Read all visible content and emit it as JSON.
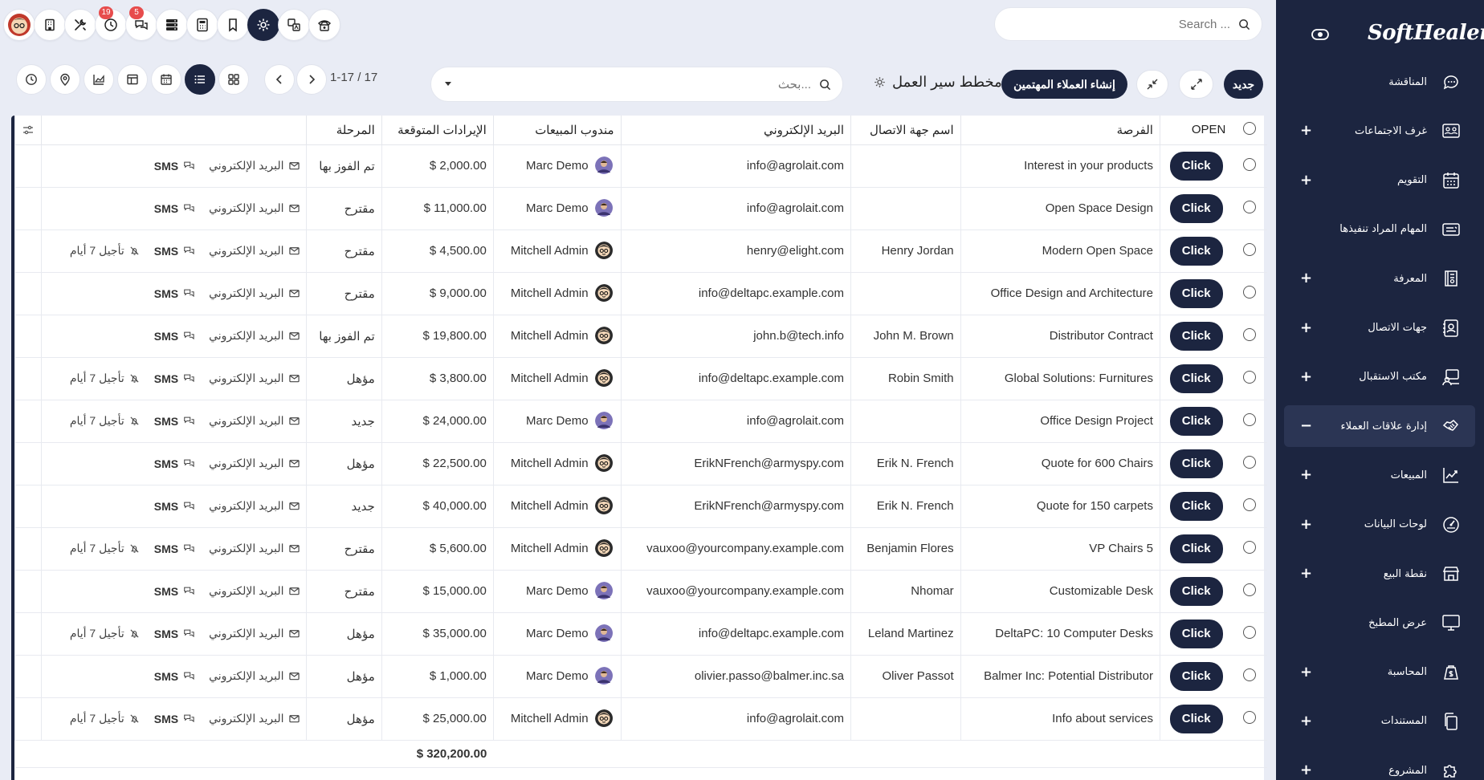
{
  "topbar": {
    "search_placeholder": "Search ...",
    "badges": {
      "activity": "19",
      "messages": "5"
    }
  },
  "control_panel": {
    "new_label": "جديد",
    "create_leads_label": "إنشاء العملاء المهتمين",
    "kanban_title": "مخطط سير العمل",
    "search_placeholder": "بحث...",
    "pager": "1-17 / 17",
    "views": [
      "kanban",
      "list",
      "calendar",
      "pivot",
      "graph",
      "map",
      "activity"
    ],
    "active_view": "list"
  },
  "table": {
    "columns": {
      "open": "OPEN",
      "opportunity": "الفرصة",
      "contact": "اسم جهة الاتصال",
      "email": "البريد الإلكتروني",
      "salesperson": "مندوب المبيعات",
      "revenue": "الإيرادات المتوقعة",
      "stage": "المرحلة"
    },
    "button_label": "Click",
    "email_action": "البريد الإلكتروني",
    "sms_action": "SMS",
    "snooze_action": "تأجيل 7 أيام",
    "rows": [
      {
        "opportunity": "Interest in your products",
        "contact": "",
        "email": "info@agrolait.com",
        "salesperson": "Marc Demo",
        "revenue": "$ 2,000.00",
        "stage": "تم الفوز بها",
        "snooze": false
      },
      {
        "opportunity": "Open Space Design",
        "contact": "",
        "email": "info@agrolait.com",
        "salesperson": "Marc Demo",
        "revenue": "$ 11,000.00",
        "stage": "مقترح",
        "snooze": false
      },
      {
        "opportunity": "Modern Open Space",
        "contact": "Henry Jordan",
        "email": "henry@elight.com",
        "salesperson": "Mitchell Admin",
        "revenue": "$ 4,500.00",
        "stage": "مقترح",
        "snooze": true
      },
      {
        "opportunity": "Office Design and Architecture",
        "contact": "",
        "email": "info@deltapc.example.com",
        "salesperson": "Mitchell Admin",
        "revenue": "$ 9,000.00",
        "stage": "مقترح",
        "snooze": false
      },
      {
        "opportunity": "Distributor Contract",
        "contact": "John M. Brown",
        "email": "john.b@tech.info",
        "salesperson": "Mitchell Admin",
        "revenue": "$ 19,800.00",
        "stage": "تم الفوز بها",
        "snooze": false
      },
      {
        "opportunity": "Global Solutions: Furnitures",
        "contact": "Robin Smith",
        "email": "info@deltapc.example.com",
        "salesperson": "Mitchell Admin",
        "revenue": "$ 3,800.00",
        "stage": "مؤهل",
        "snooze": true
      },
      {
        "opportunity": "Office Design Project",
        "contact": "",
        "email": "info@agrolait.com",
        "salesperson": "Marc Demo",
        "revenue": "$ 24,000.00",
        "stage": "جديد",
        "snooze": true
      },
      {
        "opportunity": "Quote for 600 Chairs",
        "contact": "Erik N. French",
        "email": "ErikNFrench@armyspy.com",
        "salesperson": "Mitchell Admin",
        "revenue": "$ 22,500.00",
        "stage": "مؤهل",
        "snooze": false
      },
      {
        "opportunity": "Quote for 150 carpets",
        "contact": "Erik N. French",
        "email": "ErikNFrench@armyspy.com",
        "salesperson": "Mitchell Admin",
        "revenue": "$ 40,000.00",
        "stage": "جديد",
        "snooze": false
      },
      {
        "opportunity": "VP Chairs 5",
        "contact": "Benjamin Flores",
        "email": "vauxoo@yourcompany.example.com",
        "salesperson": "Mitchell Admin",
        "revenue": "$ 5,600.00",
        "stage": "مقترح",
        "snooze": true
      },
      {
        "opportunity": "Customizable Desk",
        "contact": "Nhomar",
        "email": "vauxoo@yourcompany.example.com",
        "salesperson": "Marc Demo",
        "revenue": "$ 15,000.00",
        "stage": "مقترح",
        "snooze": false
      },
      {
        "opportunity": "DeltaPC: 10 Computer Desks",
        "contact": "Leland Martinez",
        "email": "info@deltapc.example.com",
        "salesperson": "Marc Demo",
        "revenue": "$ 35,000.00",
        "stage": "مؤهل",
        "snooze": true
      },
      {
        "opportunity": "Balmer Inc: Potential Distributor",
        "contact": "Oliver Passot",
        "email": "olivier.passo@balmer.inc.sa",
        "salesperson": "Marc Demo",
        "revenue": "$ 1,000.00",
        "stage": "مؤهل",
        "snooze": false
      },
      {
        "opportunity": "Info about services",
        "contact": "",
        "email": "info@agrolait.com",
        "salesperson": "Mitchell Admin",
        "revenue": "$ 25,000.00",
        "stage": "مؤهل",
        "snooze": true
      }
    ],
    "total_revenue": "$ 320,200.00"
  },
  "sidebar": {
    "logo": "SoftHealer",
    "items": [
      {
        "label": "المناقشة",
        "icon": "chat-icon",
        "expand": ""
      },
      {
        "label": "غرف الاجتماعات",
        "icon": "meeting-rooms-icon",
        "expand": "+"
      },
      {
        "label": "التقويم",
        "icon": "calendar-icon",
        "expand": "+"
      },
      {
        "label": "المهام المراد تنفيذها",
        "icon": "todo-icon",
        "expand": ""
      },
      {
        "label": "المعرفة",
        "icon": "knowledge-icon",
        "expand": "+"
      },
      {
        "label": "جهات الاتصال",
        "icon": "contacts-icon",
        "expand": "+"
      },
      {
        "label": "مكتب الاستقبال",
        "icon": "frontdesk-icon",
        "expand": "+"
      },
      {
        "label": "إدارة علاقات العملاء",
        "icon": "crm-icon",
        "expand": "−",
        "active": true
      },
      {
        "label": "المبيعات",
        "icon": "sales-icon",
        "expand": "+"
      },
      {
        "label": "لوحات البيانات",
        "icon": "dashboard-icon",
        "expand": "+"
      },
      {
        "label": "نقطة البيع",
        "icon": "pos-icon",
        "expand": "+"
      },
      {
        "label": "عرض المطبخ",
        "icon": "kitchen-display-icon",
        "expand": ""
      },
      {
        "label": "المحاسبة",
        "icon": "accounting-icon",
        "expand": "+"
      },
      {
        "label": "المستندات",
        "icon": "documents-icon",
        "expand": "+"
      },
      {
        "label": "المشروع",
        "icon": "project-icon",
        "expand": "+"
      }
    ]
  }
}
